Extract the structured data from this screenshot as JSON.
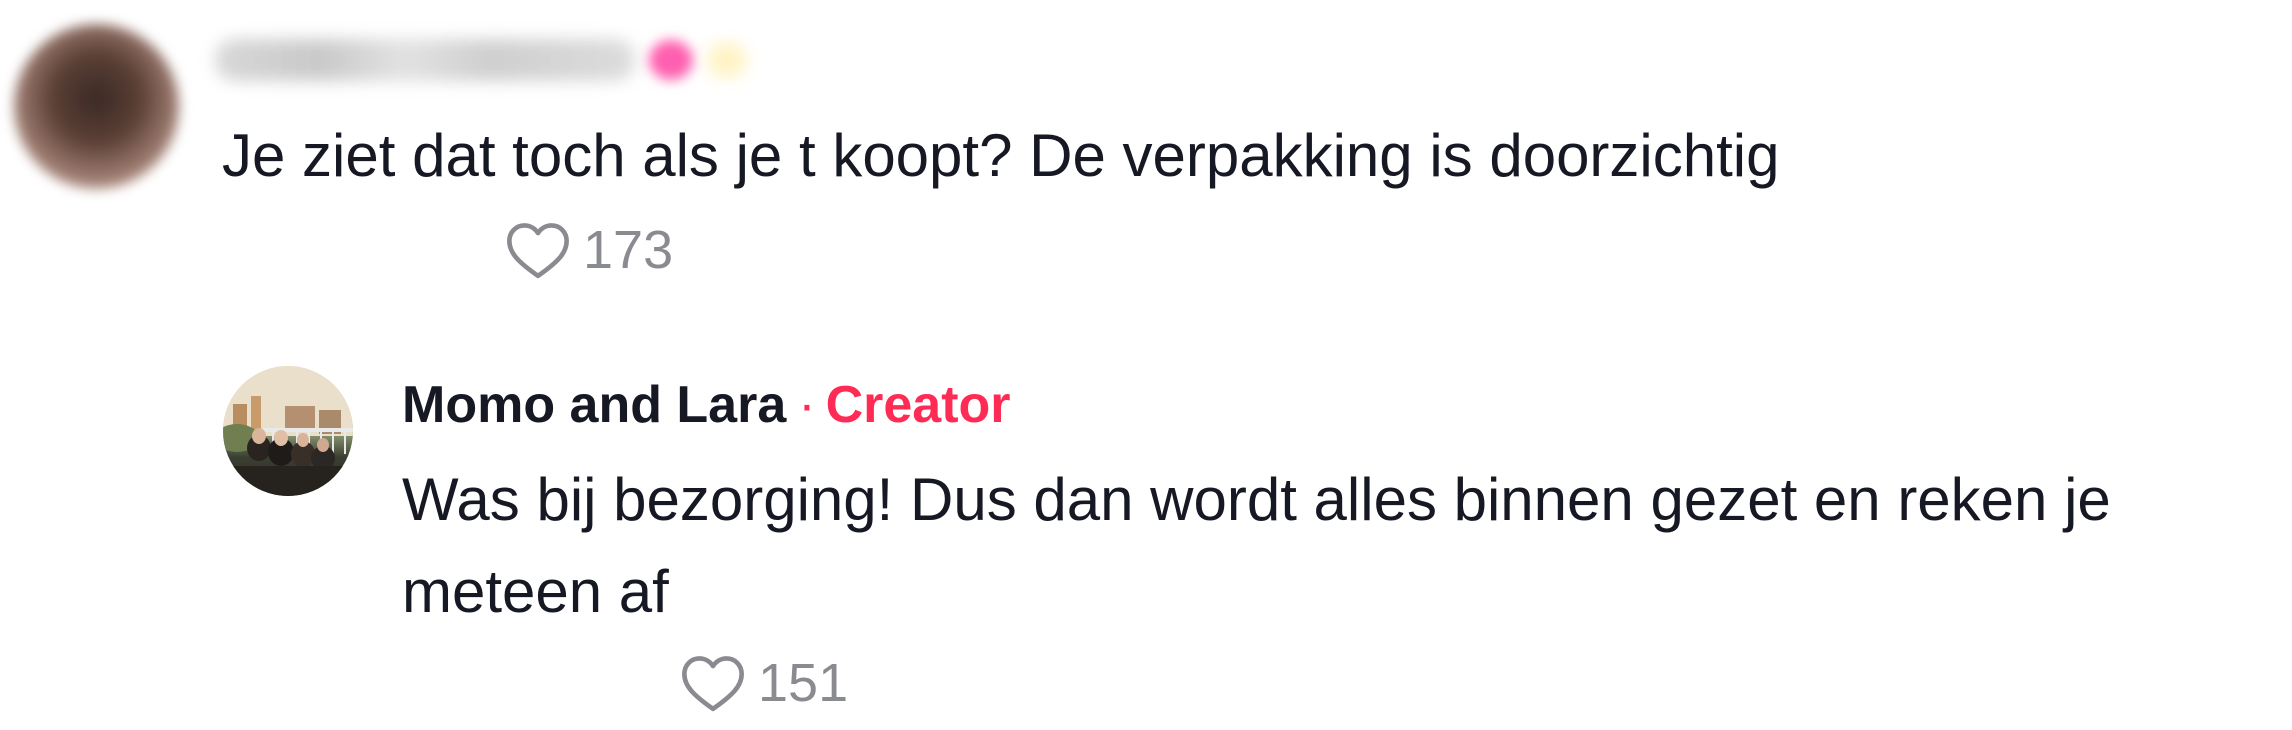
{
  "comments": [
    {
      "author": "",
      "text": "Je ziet dat toch als je t koopt? De verpakking is doorzichtig",
      "likes": "173",
      "icon": "heart-outline-icon"
    }
  ],
  "reply": {
    "author": "Momo and Lara",
    "separator": "·",
    "badge": "Creator",
    "text": "Was bij bezorging! Dus dan wordt alles binnen gezet en reken je meteen af",
    "likes": "151",
    "icon": "heart-outline-icon"
  },
  "colors": {
    "text": "#161823",
    "muted": "#8a8b91",
    "creator": "#fe2c55"
  }
}
